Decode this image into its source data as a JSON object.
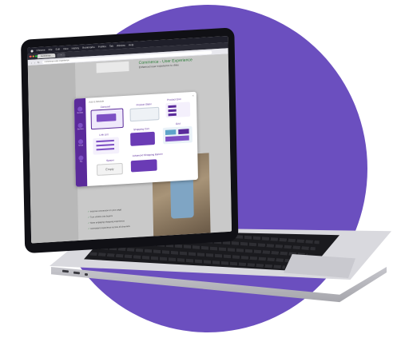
{
  "os_menu": {
    "items": [
      "Chrome",
      "File",
      "Edit",
      "View",
      "History",
      "Bookmarks",
      "Profiles",
      "Tab",
      "Window",
      "Help"
    ]
  },
  "browser": {
    "tab_active": "Commerce...",
    "url": "commerce-user-experience"
  },
  "page": {
    "heading": "Commerce - User Experience",
    "subheading": "Enhanced user experience to drive",
    "bullets": [
      "Improve conversion on your page",
      "Turn visitors into buyers",
      "More engaging shopping experience",
      "Consistent experience across all channels"
    ]
  },
  "modal": {
    "title": "Add a Module",
    "close": "×",
    "sidebar": [
      "Modules",
      "Sections",
      "Saved",
      "Pre"
    ],
    "tiles": [
      {
        "label": "Carousel"
      },
      {
        "label": "Product Slider"
      },
      {
        "label": "Product Grid"
      },
      {
        "label": "Link List"
      },
      {
        "label": "Shopping Cart"
      },
      {
        "label": "Grid"
      },
      {
        "label": "Spacer"
      },
      {
        "label": "Advanced Shopping Banner"
      }
    ],
    "empty_label": "Empty"
  },
  "colors": {
    "background_circle": "#6b4fbf",
    "accent": "#5a2a9a",
    "heading_green": "#2f7f3c"
  }
}
